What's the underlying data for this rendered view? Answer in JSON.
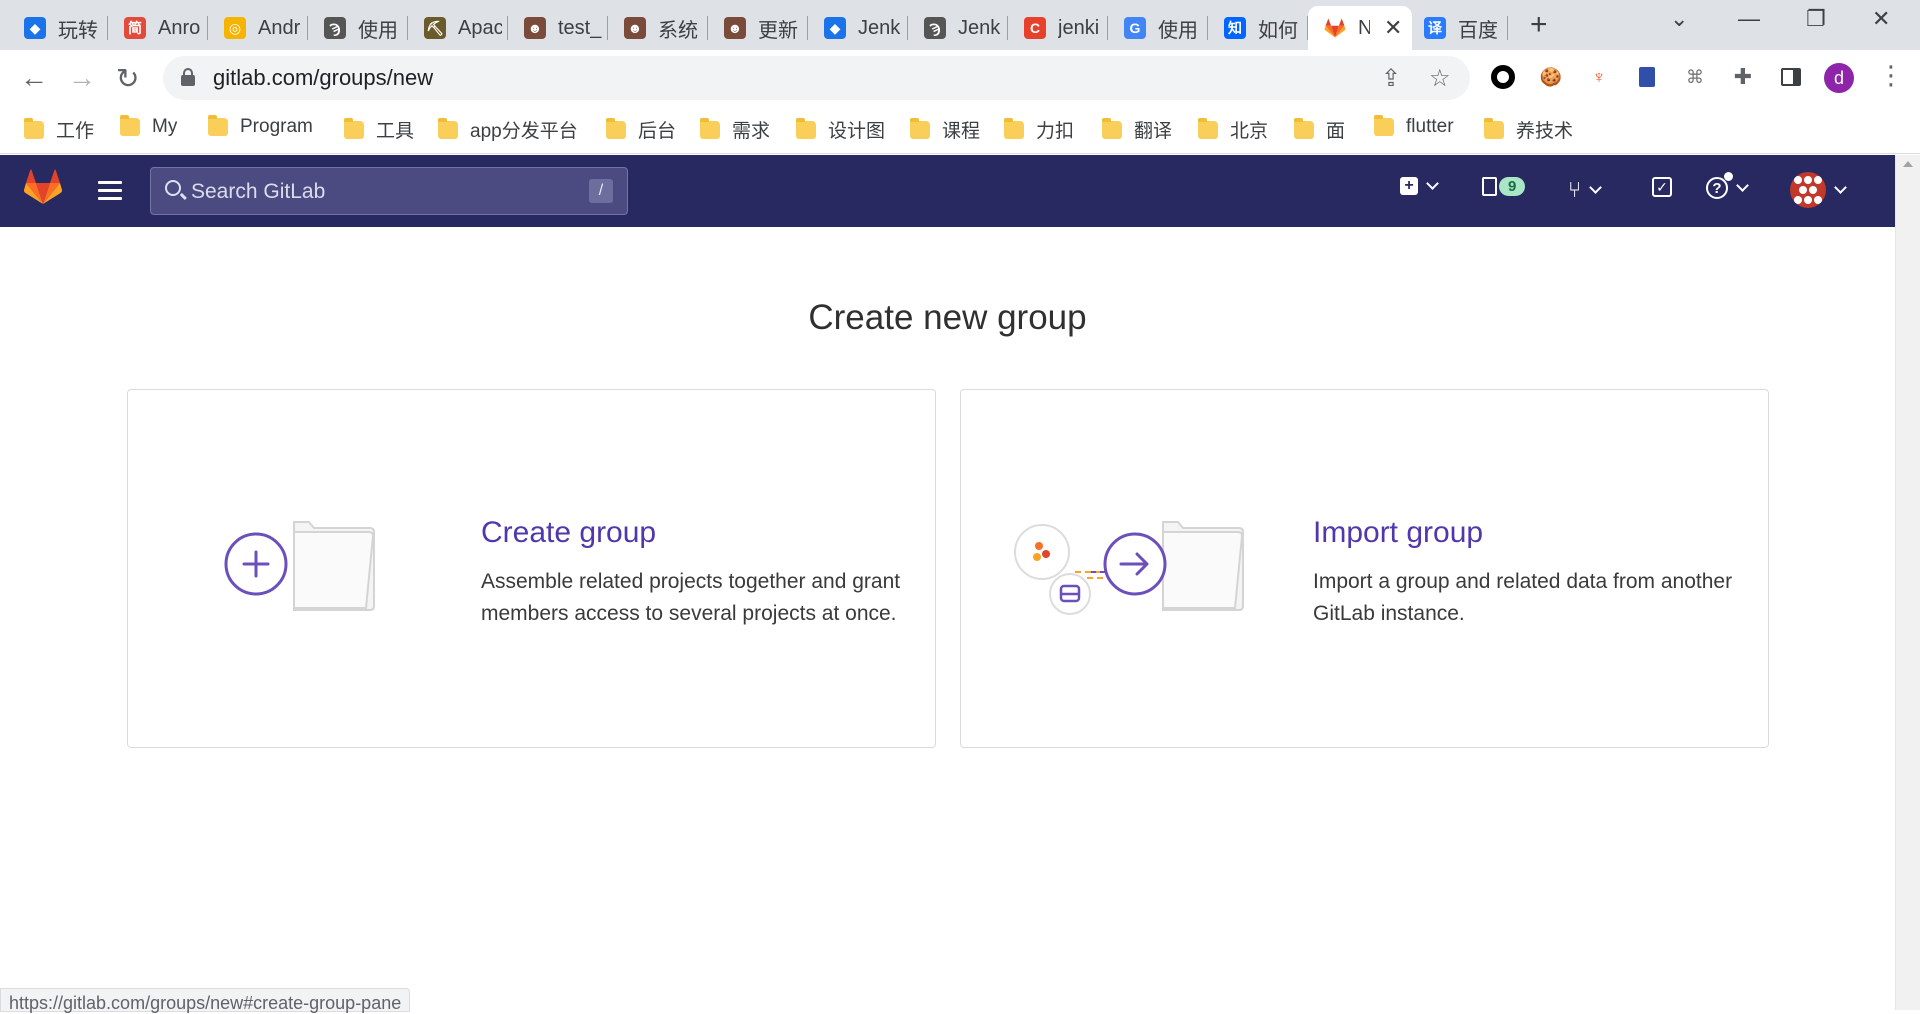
{
  "browser": {
    "tabs": [
      {
        "title": "玩转",
        "favicon_text": "◆",
        "color": "#1a73e8"
      },
      {
        "title": "Anro",
        "favicon_text": "简",
        "color": "#e24b3b"
      },
      {
        "title": "Andr",
        "favicon_text": "◎",
        "color": "#f4b400"
      },
      {
        "title": "使用",
        "favicon_text": "Ϡ",
        "color": "#555555"
      },
      {
        "title": "Apac",
        "favicon_text": "⛏",
        "color": "#6b5b2b"
      },
      {
        "title": "test_",
        "favicon_text": "☻",
        "color": "#7a4a3a"
      },
      {
        "title": "系统",
        "favicon_text": "☻",
        "color": "#7a4a3a"
      },
      {
        "title": "更新",
        "favicon_text": "☻",
        "color": "#7a4a3a"
      },
      {
        "title": "Jenk",
        "favicon_text": "◆",
        "color": "#1a73e8"
      },
      {
        "title": "Jenk",
        "favicon_text": "Ϡ",
        "color": "#555555"
      },
      {
        "title": "jenki",
        "favicon_text": "C",
        "color": "#e8412b"
      },
      {
        "title": "使用",
        "favicon_text": "G",
        "color": "#4285f4"
      },
      {
        "title": "如何",
        "favicon_text": "知",
        "color": "#0066ff"
      },
      {
        "title": "N",
        "favicon_text": "",
        "color": "#fc6d26",
        "active": true
      },
      {
        "title": "百度",
        "favicon_text": "译",
        "color": "#2b7bff"
      }
    ],
    "tab_close": "✕",
    "new_tab": "+",
    "url": "gitlab.com/groups/new",
    "profile_letter": "d",
    "bookmarks": [
      "工作",
      "My",
      "Program",
      "工具",
      "app分发平台",
      "后台",
      "需求",
      "设计图",
      "课程",
      "力扣",
      "翻译",
      "北京",
      "面",
      "flutter",
      "养技术"
    ],
    "status_url": "https://gitlab.com/groups/new#create-group-pane"
  },
  "gitlab": {
    "search_placeholder": "Search GitLab",
    "search_shortcut": "/",
    "merge_requests_count": "9"
  },
  "page": {
    "title": "Create new group",
    "panels": [
      {
        "heading": "Create group",
        "description": "Assemble related projects together and grant members access to several projects at once."
      },
      {
        "heading": "Import group",
        "description": "Import a group and related data from another GitLab instance."
      }
    ]
  },
  "colors": {
    "gitlab_header": "#292961",
    "accent_purple": "#4f37ad",
    "gitlab_orange": "#fc6d26"
  }
}
